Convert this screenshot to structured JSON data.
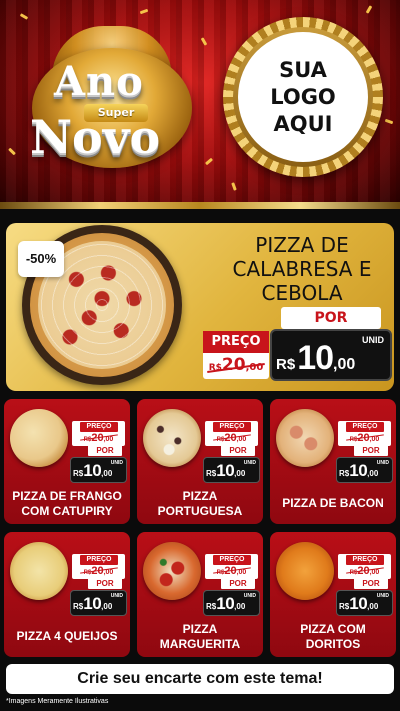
{
  "header": {
    "title_line1": "Ano",
    "title_badge": "Super",
    "title_line2": "Novo",
    "logo_line1": "SUA",
    "logo_line2": "LOGO",
    "logo_line3": "AQUI"
  },
  "featured": {
    "discount": "-50%",
    "name_line1": "PIZZA DE",
    "name_line2": "CALABRESA E",
    "name_line3": "CEBOLA",
    "por_label": "POR",
    "preco_label": "PREÇO",
    "old_currency": "R$",
    "old_int": "20",
    "old_cents": ",00",
    "unit_label": "UNID",
    "currency": "R$",
    "price_int": "10",
    "price_cents": ",00"
  },
  "card_labels": {
    "preco": "PREÇO",
    "por": "POR",
    "unid": "UNID",
    "currency": "R$"
  },
  "products": [
    {
      "name_line1": "PIZZA DE FRANGO",
      "name_line2": "COM CATUPIRY",
      "old_int": "20",
      "old_cents": ",00",
      "price_int": "10",
      "price_cents": ",00"
    },
    {
      "name_line1": "PIZZA",
      "name_line2": "PORTUGUESA",
      "old_int": "20",
      "old_cents": ",00",
      "price_int": "10",
      "price_cents": ",00"
    },
    {
      "name_line1": "PIZZA DE BACON",
      "name_line2": "",
      "old_int": "20",
      "old_cents": ",00",
      "price_int": "10",
      "price_cents": ",00"
    },
    {
      "name_line1": "PIZZA 4 QUEIJOS",
      "name_line2": "",
      "old_int": "20",
      "old_cents": ",00",
      "price_int": "10",
      "price_cents": ",00"
    },
    {
      "name_line1": "PIZZA",
      "name_line2": "MARGUERITA",
      "old_int": "20",
      "old_cents": ",00",
      "price_int": "10",
      "price_cents": ",00"
    },
    {
      "name_line1": "PIZZA COM",
      "name_line2": "DORITOS",
      "old_int": "20",
      "old_cents": ",00",
      "price_int": "10",
      "price_cents": ",00"
    }
  ],
  "footer": {
    "cta": "Crie seu encarte com este tema!",
    "disclaimer": "*Imagens Meramente Ilustrativas"
  },
  "colors": {
    "brand_red": "#c8141b",
    "gold": "#e1b53e",
    "card_red": "#b90f17",
    "price_box": "#111111"
  }
}
